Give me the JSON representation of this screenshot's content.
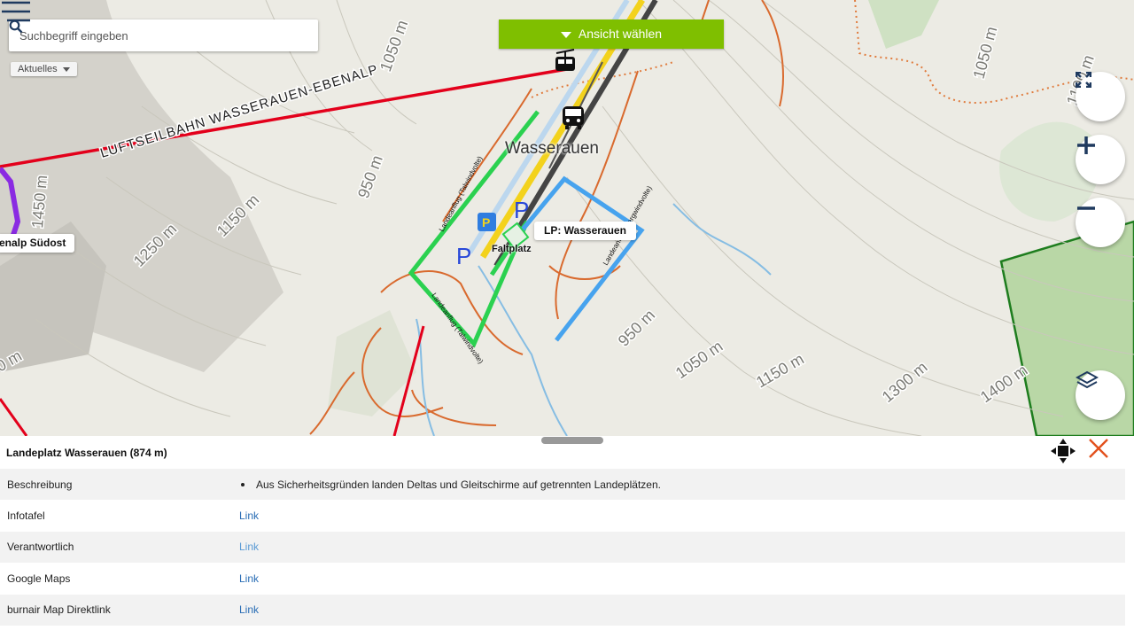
{
  "search": {
    "placeholder": "Suchbegriff eingeben"
  },
  "filter": {
    "label": "Aktuelles"
  },
  "view_button": {
    "label": "Ansicht wählen"
  },
  "map": {
    "place_name": "Wasserauen",
    "landing_label": "LP: Wasserauen",
    "takeoff_label": "enalp Südost",
    "faltplatz_label": "Faltplatz",
    "cableway_label": "LUFTSEILBAHN WASSERAUEN-EBENALP",
    "approach_green_1": "Landeanflug (Talwindvolte)",
    "approach_green_2": "Landeanflug (Talwindvolte)",
    "approach_blue": "Landeanflug (Bergwindvolte)",
    "contours": [
      "1050 m",
      "950 m",
      "1150 m",
      "1250 m",
      "1450 m",
      "1050 m",
      "1100 m",
      "950 m",
      "1050 m",
      "1150 m",
      "1300 m",
      "1400 m",
      "0 m"
    ],
    "parking_symbol": "P"
  },
  "panel": {
    "title": "Landeplatz Wasserauen (874 m)",
    "rows": [
      {
        "key": "Beschreibung",
        "value": "Aus Sicherheitsgründen landen Deltas und Gleitschirme auf getrennten Landeplätzen."
      },
      {
        "key": "Infotafel",
        "value": "Link"
      },
      {
        "key": "Verantwortlich",
        "value": "Link"
      },
      {
        "key": "Google Maps",
        "value": "Link"
      },
      {
        "key": "burnair Map Direktlink",
        "value": "Link"
      }
    ]
  },
  "colors": {
    "accent_green": "#7fbf00",
    "cableway_red": "#e3001b",
    "approach_green": "#2bd150",
    "approach_blue": "#47a3ee",
    "close_orange": "#e2501c",
    "button_navy": "#1f3a5f"
  },
  "icons": [
    "search-icon",
    "menu-icon",
    "fullscreen-icon",
    "zoom-in-icon",
    "zoom-out-icon",
    "layers-icon",
    "cable-car-icon",
    "bus-icon",
    "parking-icon",
    "move-icon",
    "close-icon"
  ]
}
